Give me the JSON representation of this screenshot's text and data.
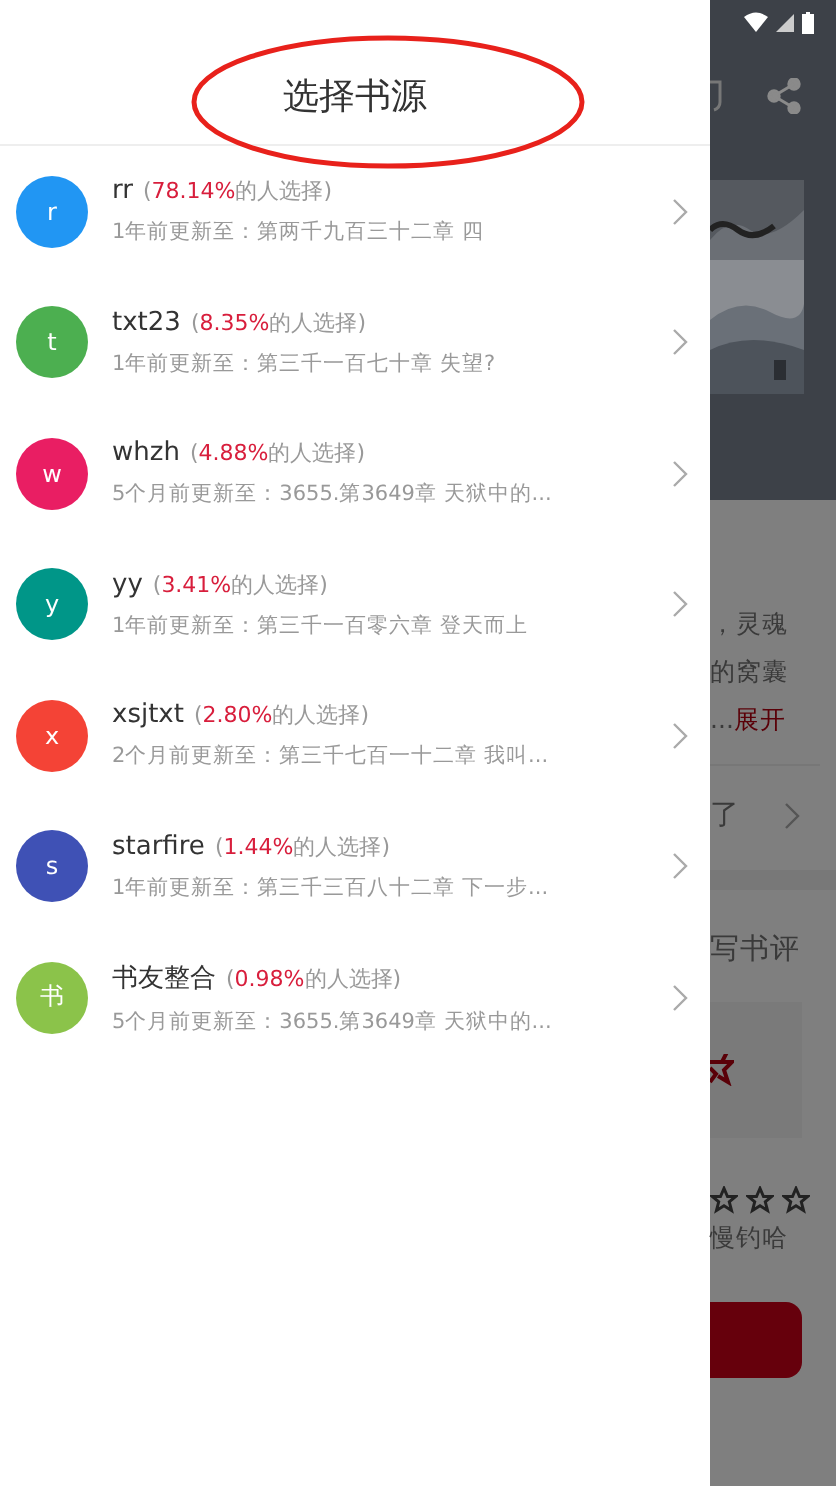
{
  "drawer": {
    "title": "选择书源",
    "sources": [
      {
        "avatar": "r",
        "color": "#2196f3",
        "name": "rr",
        "prefix": "(",
        "percent": "78.14%",
        "suffix": "的人选择)",
        "update": "1年前更新至：第两千九百三十二章 四"
      },
      {
        "avatar": "t",
        "color": "#4caf50",
        "name": "txt23",
        "prefix": "(",
        "percent": "8.35%",
        "suffix": "的人选择)",
        "update": "1年前更新至：第三千一百七十章 失望?"
      },
      {
        "avatar": "w",
        "color": "#e91e63",
        "name": "whzh",
        "prefix": "(",
        "percent": "4.88%",
        "suffix": "的人选择)",
        "update": "5个月前更新至：3655.第3649章 天狱中的..."
      },
      {
        "avatar": "y",
        "color": "#009688",
        "name": "yy",
        "prefix": "(",
        "percent": "3.41%",
        "suffix": "的人选择)",
        "update": "1年前更新至：第三千一百零六章 登天而上"
      },
      {
        "avatar": "x",
        "color": "#f44336",
        "name": "xsjtxt",
        "prefix": "(",
        "percent": "2.80%",
        "suffix": "的人选择)",
        "update": "2个月前更新至：第三千七百一十二章 我叫..."
      },
      {
        "avatar": "s",
        "color": "#3f51b5",
        "name": "starfire",
        "prefix": "(",
        "percent": "1.44%",
        "suffix": "的人选择)",
        "update": "1年前更新至：第三千三百八十二章 下一步..."
      },
      {
        "avatar": "书",
        "color": "#8bc34a",
        "name": "书友整合",
        "prefix": "(",
        "percent": "0.98%",
        "suffix": "的人选择)",
        "update": "5个月前更新至：3655.第3649章 天狱中的..."
      }
    ]
  },
  "background": {
    "intro_lines": [
      "，灵魂",
      "的窝囊"
    ],
    "expand": "展开",
    "expand_prefix": "...",
    "latest": "了",
    "review": "写书评",
    "comment": "慢钓哈"
  }
}
